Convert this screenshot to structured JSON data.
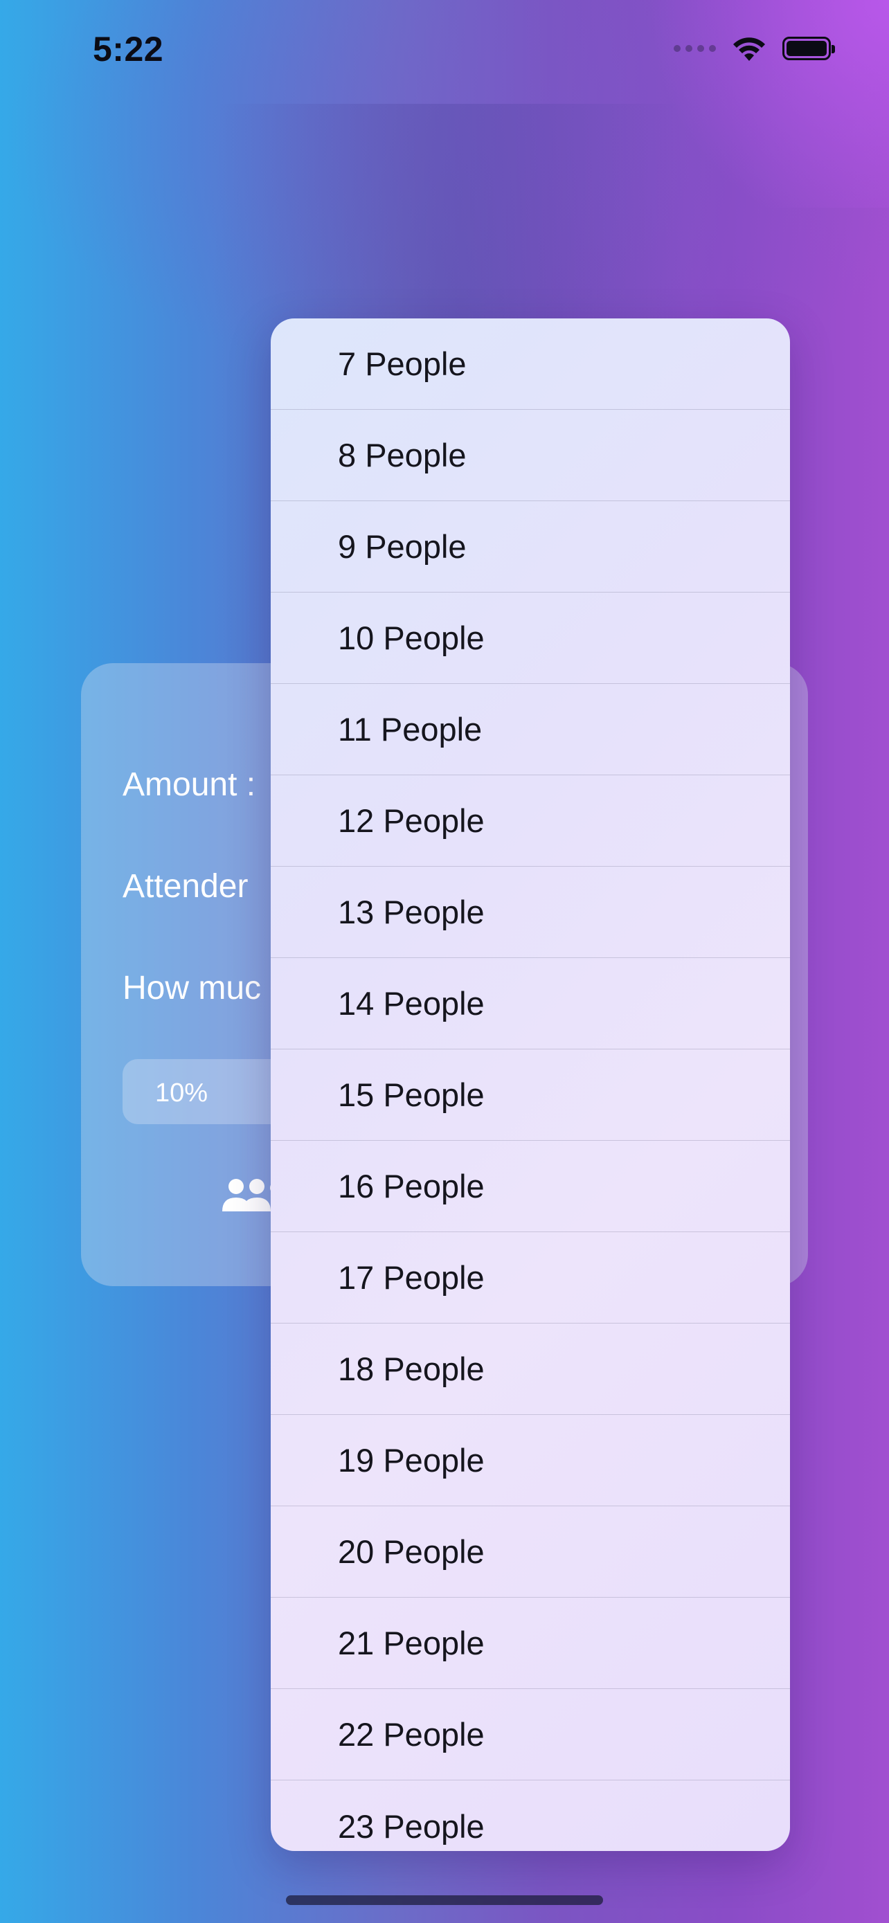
{
  "status_bar": {
    "time": "5:22"
  },
  "card": {
    "amount_label": "Amount :",
    "attender_label": "Attender",
    "how_much_label": "How muc",
    "tip_option": "10%",
    "people_icon": "people-icon"
  },
  "dropdown": {
    "items": [
      "7 People",
      "8 People",
      "9 People",
      "10 People",
      "11 People",
      "12 People",
      "13 People",
      "14 People",
      "15 People",
      "16 People",
      "17 People",
      "18 People",
      "19 People",
      "20 People",
      "21 People",
      "22 People",
      "23 People"
    ]
  },
  "colors": {
    "gradient_left": "#35a9e8",
    "gradient_right": "#a14fd0",
    "menu_text": "#15151d"
  }
}
